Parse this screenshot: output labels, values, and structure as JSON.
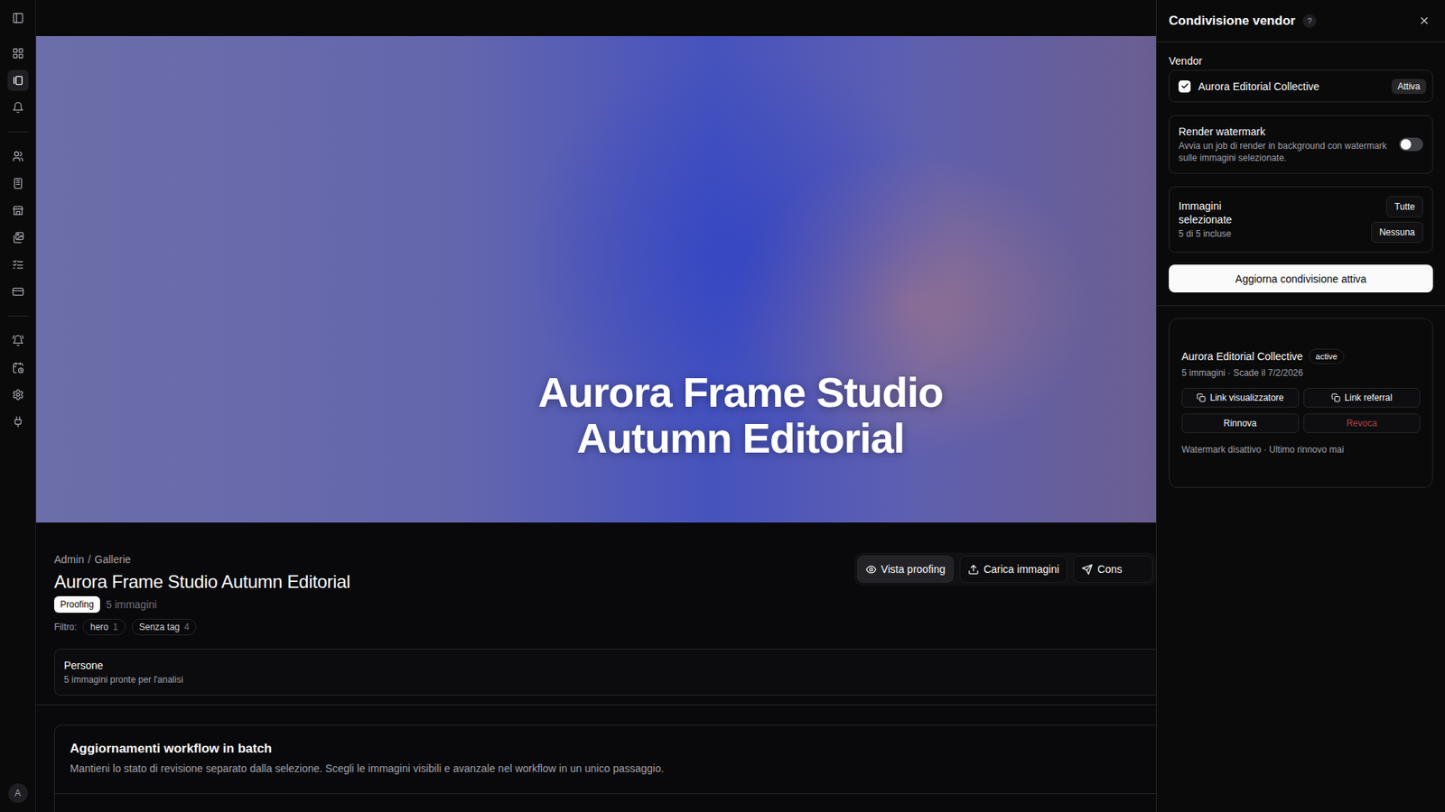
{
  "sidebar": {
    "groups": [
      {
        "items": [
          {
            "selected": false
          },
          {
            "selected": true
          },
          {
            "selected": false
          }
        ]
      },
      {
        "items": [
          {
            "selected": false
          },
          {
            "selected": false
          },
          {
            "selected": false
          },
          {
            "selected": false
          },
          {
            "selected": false
          },
          {
            "selected": false
          }
        ]
      },
      {
        "items": [
          {
            "selected": false
          },
          {
            "selected": false
          },
          {
            "selected": false
          },
          {
            "selected": false
          }
        ]
      }
    ],
    "avatar": "A"
  },
  "hero": {
    "title": [
      "Aurora Frame Studio",
      "Autumn Editorial"
    ]
  },
  "breadcrumb": {
    "items": [
      "Admin",
      "Gallerie"
    ],
    "separator": "/"
  },
  "gallery": {
    "title": "Aurora Frame Studio Autumn Editorial",
    "status": "Proofing",
    "image_count": "5 immagini",
    "filter_label": "Filtro:",
    "filters": [
      {
        "label": "hero",
        "count": "1"
      },
      {
        "label": "Senza tag",
        "count": "4"
      }
    ]
  },
  "actions": [
    {
      "label": "Vista proofing",
      "selected": true
    },
    {
      "label": "Carica immagini",
      "selected": false
    },
    {
      "label": "Cons",
      "selected": false
    }
  ],
  "people": {
    "title": "Persone",
    "subtitle": "5 immagini pronte per l'analisi"
  },
  "batch": {
    "title": "Aggiornamenti workflow in batch",
    "description": "Mantieni lo stato di revisione separato dalla selezione. Scegli le immagini visibili e avanzale nel workflow in un unico passaggio."
  },
  "panel": {
    "title": "Condivisione vendor",
    "help": "?",
    "vendor_label": "Vendor",
    "vendors": [
      {
        "name": "Aurora Editorial Collective",
        "checked": true,
        "status": "Attiva"
      }
    ],
    "watermark": {
      "title": "Render watermark",
      "description": "Avvia un job di render in background con watermark sulle immagini selezionate.",
      "on": false
    },
    "images": {
      "title": "Immagini selezionate",
      "summary": "5 di 5 incluse",
      "buttons": [
        "Tutte",
        "Nessuna"
      ]
    },
    "submit": "Aggiorna condivisione attiva",
    "shares": [
      {
        "name": "Aurora Editorial Collective",
        "status": "active",
        "meta": "5 immagini · Scade il 7/2/2026",
        "buttons": [
          {
            "label": "Link visualizzatore",
            "kind": "copy"
          },
          {
            "label": "Link referral",
            "kind": "copy"
          },
          {
            "label": "Rinnova",
            "kind": "default"
          },
          {
            "label": "Revoca",
            "kind": "danger"
          }
        ],
        "footer": "Watermark disattivo · Ultimo rinnovo mai"
      }
    ]
  }
}
